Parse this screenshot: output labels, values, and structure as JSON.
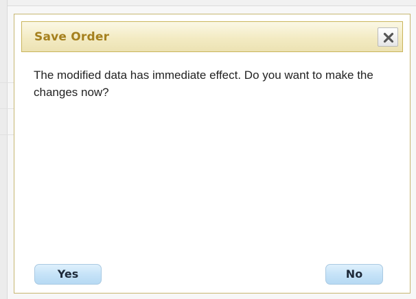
{
  "dialog": {
    "title": "Save Order",
    "close_icon": "close-x-icon",
    "message": "The modified data has immediate effect. Do you want to make the changes now?",
    "buttons": {
      "yes_label": "Yes",
      "no_label": "No"
    }
  },
  "colors": {
    "title_text": "#a5801e",
    "title_bar": "#f3ebc3",
    "button_fill": "#c6e3f8"
  }
}
